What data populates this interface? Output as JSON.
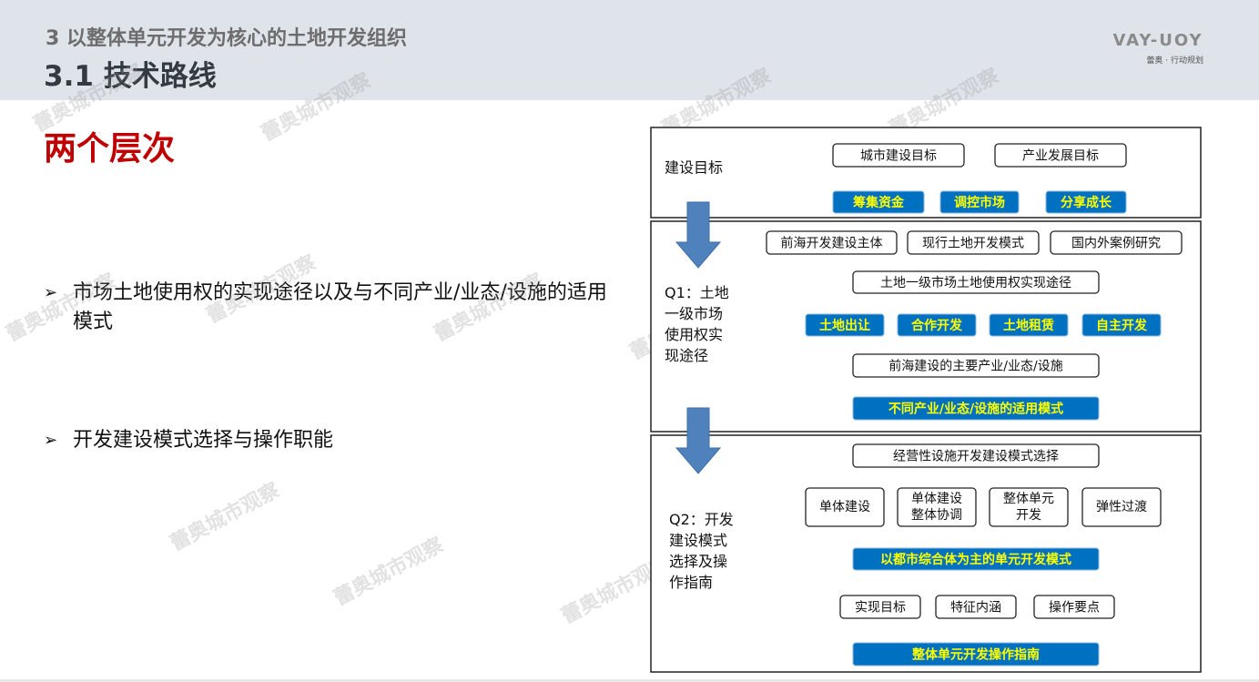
{
  "header": {
    "section": "3 以整体单元开发为核心的土地开发组织",
    "title": "3.1 技术路线",
    "logo_mark": "VAY-UOY",
    "logo_sub": "蕾奥 · 行动规划"
  },
  "main": {
    "heading": "两个层次",
    "bullets": [
      {
        "mark": "➢",
        "text": "市场土地使用权的实现途径以及与不同产业/业态/设施的适用模式"
      },
      {
        "mark": "➢",
        "text": "开发建设模式选择与操作职能"
      }
    ]
  },
  "watermark": "蕾奥城市观察",
  "diagram": {
    "panel1": {
      "label": "建设目标",
      "inputs": [
        "城市建设目标",
        "产业发展目标"
      ],
      "outputs": [
        "筹集资金",
        "调控市场",
        "分享成长"
      ]
    },
    "panel2": {
      "label_lines": [
        "Q1：土地",
        "一级市场",
        "使用权实",
        "现途径"
      ],
      "inputs": [
        "前海开发建设主体",
        "现行土地开发模式",
        "国内外案例研究"
      ],
      "hub": "土地一级市场土地使用权实现途径",
      "methods": [
        "土地出让",
        "合作开发",
        "土地租赁",
        "自主开发"
      ],
      "summary": "前海建设的主要产业/业态/设施",
      "result": "不同产业/业态/设施的适用模式"
    },
    "panel3": {
      "label_lines": [
        "Q2：开发",
        "建设模式",
        "选择及操",
        "作指南"
      ],
      "hub": "经营性设施开发建设模式选择",
      "options": [
        [
          "单体建设"
        ],
        [
          "单体建设",
          "整体协调"
        ],
        [
          "整体单元",
          "开发"
        ],
        [
          "弹性过渡"
        ]
      ],
      "mode": "以都市综合体为主的单元开发模式",
      "aspects": [
        "实现目标",
        "特征内涵",
        "操作要点"
      ],
      "result": "整体单元开发操作指南"
    }
  },
  "colors": {
    "accent_red": "#c00000",
    "box_blue": "#0070c0",
    "box_text_yellow": "#ffff00",
    "arrow_blue": "#4f81bd",
    "header_bg": "#dfe4ea"
  }
}
